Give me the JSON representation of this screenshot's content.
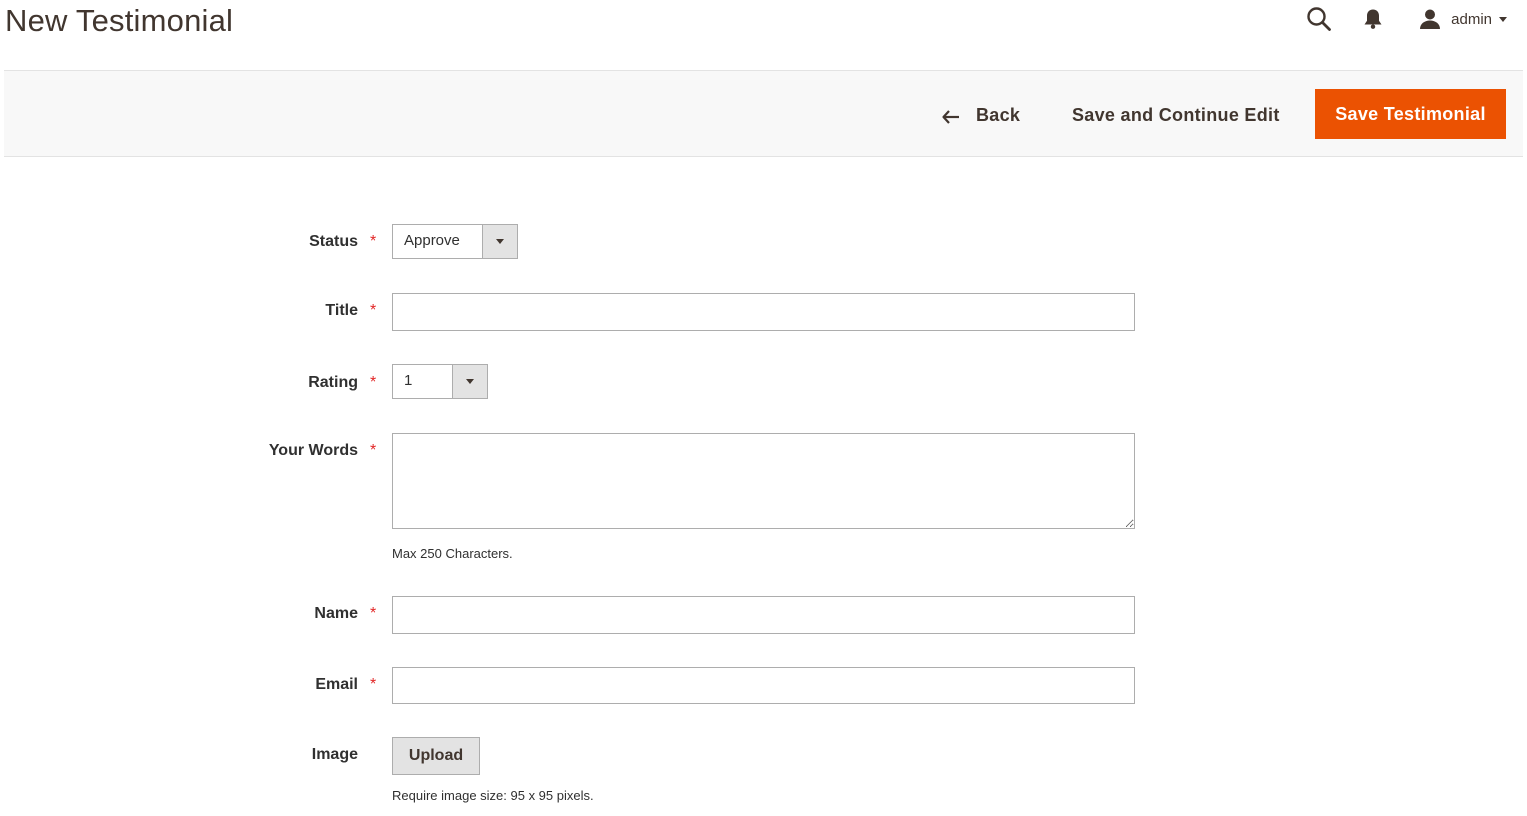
{
  "page": {
    "title": "New Testimonial"
  },
  "header": {
    "icons": {
      "search": "search-icon",
      "notifications": "bell-icon",
      "user": "user-icon"
    },
    "user_name": "admin"
  },
  "actions": {
    "back_label": "Back",
    "save_continue_label": "Save and Continue Edit",
    "save_label": "Save Testimonial"
  },
  "colors": {
    "accent": "#eb5202",
    "required": "#e22626"
  },
  "form": {
    "status": {
      "label": "Status",
      "required_mark": "*",
      "value": "Approve"
    },
    "title": {
      "label": "Title",
      "required_mark": "*",
      "value": ""
    },
    "rating": {
      "label": "Rating",
      "required_mark": "*",
      "value": "1"
    },
    "words": {
      "label": "Your Words",
      "required_mark": "*",
      "value": "",
      "note": "Max 250 Characters."
    },
    "name": {
      "label": "Name",
      "required_mark": "*",
      "value": ""
    },
    "email": {
      "label": "Email",
      "required_mark": "*",
      "value": ""
    },
    "image": {
      "label": "Image",
      "button_label": "Upload",
      "note": "Require image size: 95 x 95 pixels."
    }
  }
}
